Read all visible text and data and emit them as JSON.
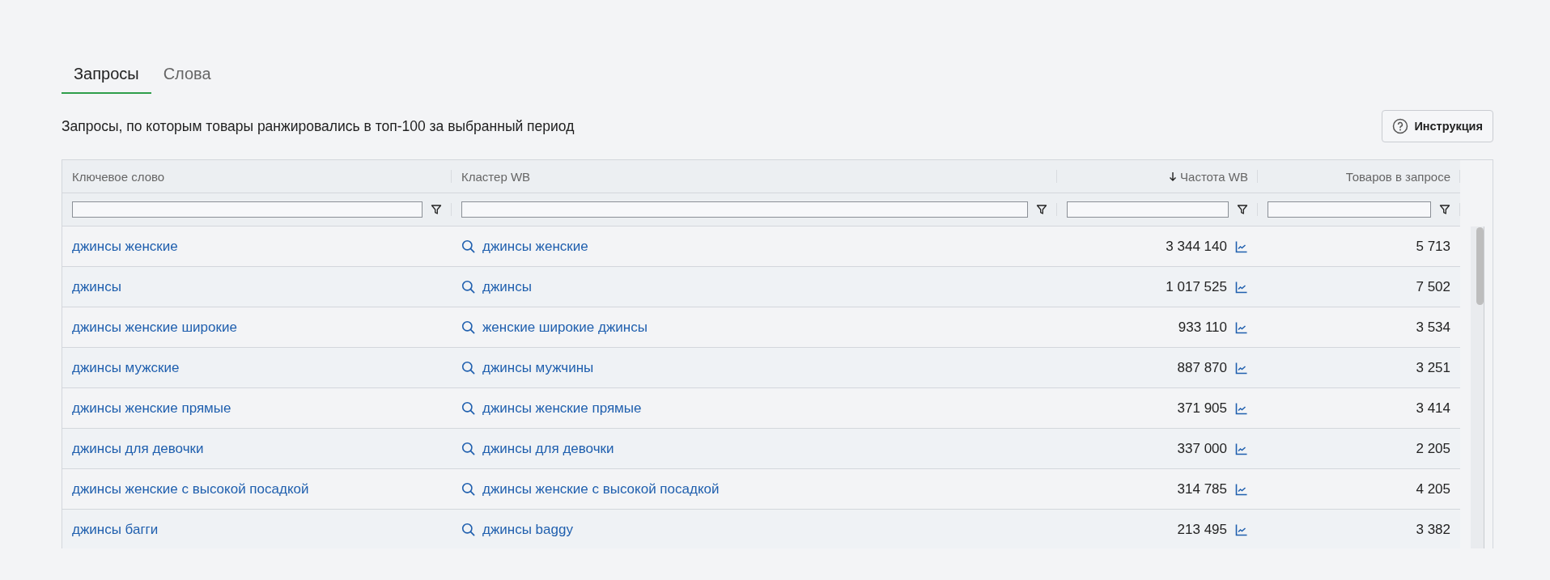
{
  "tabs": [
    {
      "label": "Запросы",
      "selected": true
    },
    {
      "label": "Слова",
      "selected": false
    }
  ],
  "description": "Запросы, по которым товары ранжировались в топ-100 за выбранный период",
  "help_button": {
    "label": "Инструкция"
  },
  "table": {
    "columns": [
      {
        "title": "Ключевое слово",
        "sorted": false
      },
      {
        "title": "Кластер WB",
        "sorted": false
      },
      {
        "title": "Частота WB",
        "sorted": true
      },
      {
        "title": "Товаров в запросе",
        "sorted": false
      }
    ],
    "rows": [
      {
        "keyword": "джинсы женские",
        "cluster": "джинсы женские",
        "frequency": "3 344 140",
        "products": "5 713"
      },
      {
        "keyword": "джинсы",
        "cluster": "джинсы",
        "frequency": "1 017 525",
        "products": "7 502"
      },
      {
        "keyword": "джинсы женские широкие",
        "cluster": "женские широкие джинсы",
        "frequency": "933 110",
        "products": "3 534"
      },
      {
        "keyword": "джинсы мужские",
        "cluster": "джинсы мужчины",
        "frequency": "887 870",
        "products": "3 251"
      },
      {
        "keyword": "джинсы женские прямые",
        "cluster": "джинсы женские прямые",
        "frequency": "371 905",
        "products": "3 414"
      },
      {
        "keyword": "джинсы для девочки",
        "cluster": "джинсы для девочки",
        "frequency": "337 000",
        "products": "2 205"
      },
      {
        "keyword": "джинсы женские с высокой посадкой",
        "cluster": "джинсы женские с высокой посадкой",
        "frequency": "314 785",
        "products": "4 205"
      },
      {
        "keyword": "джинсы багги",
        "cluster": "джинсы baggy",
        "frequency": "213 495",
        "products": "3 382"
      }
    ]
  }
}
